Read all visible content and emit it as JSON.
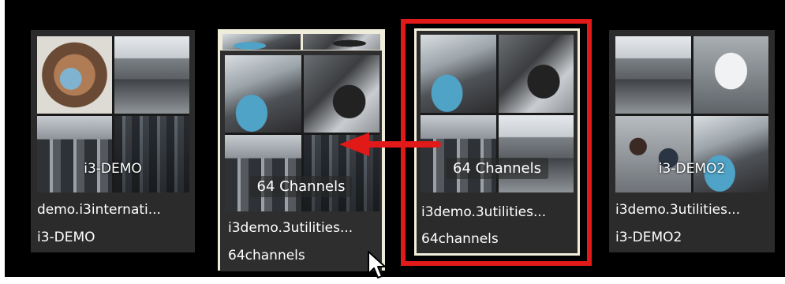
{
  "annotation": {
    "highlight_color": "#e11919",
    "arrow_color": "#e11919",
    "arrow_icon": "left-arrow-icon"
  },
  "tiles": [
    {
      "overlay": "i3-DEMO",
      "name": "demo.i3internati...",
      "sub": "i3-DEMO"
    },
    {
      "overlay": "64 Channels",
      "name": "i3demo.3utilities...",
      "sub": "64channels"
    },
    {
      "overlay": "64 Channels",
      "name": "i3demo.3utilities...",
      "sub": "64channels"
    },
    {
      "overlay": "i3-DEMO2",
      "name": "i3demo.3utilities...",
      "sub": "i3-DEMO2"
    }
  ],
  "cursor_icon": "mouse-pointer-icon"
}
